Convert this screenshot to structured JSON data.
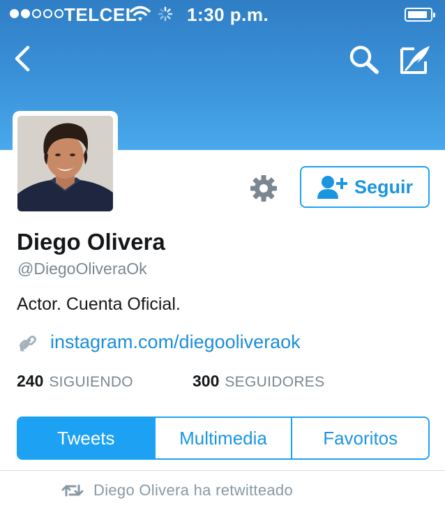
{
  "status_bar": {
    "carrier": "TELCEL",
    "time": "1:30 p.m.",
    "signal_bars_filled": 2,
    "signal_bars_total": 5
  },
  "nav": {
    "back_icon": "chevron-left-icon",
    "search_icon": "search-icon",
    "compose_icon": "compose-tweet-icon"
  },
  "profile": {
    "name": "Diego Olivera",
    "handle": "@DiegoOliveraOk",
    "bio": "Actor. Cuenta Oficial.",
    "link": "instagram.com/diegooliveraok",
    "follow_label": "Seguir",
    "settings_icon": "gear-icon"
  },
  "stats": {
    "following_count": "240",
    "following_label": "SIGUIENDO",
    "followers_count": "300",
    "followers_label": "SEGUIDORES"
  },
  "tabs": [
    {
      "label": "Tweets",
      "active": true
    },
    {
      "label": "Multimedia",
      "active": false
    },
    {
      "label": "Favoritos",
      "active": false
    }
  ],
  "timeline": {
    "retweet_notice": "Diego Olivera ha retwitteado"
  },
  "colors": {
    "header_blue": "#3b93d9",
    "accent": "#1da1f2",
    "link": "#1b8ed9",
    "muted": "#8899a6"
  }
}
